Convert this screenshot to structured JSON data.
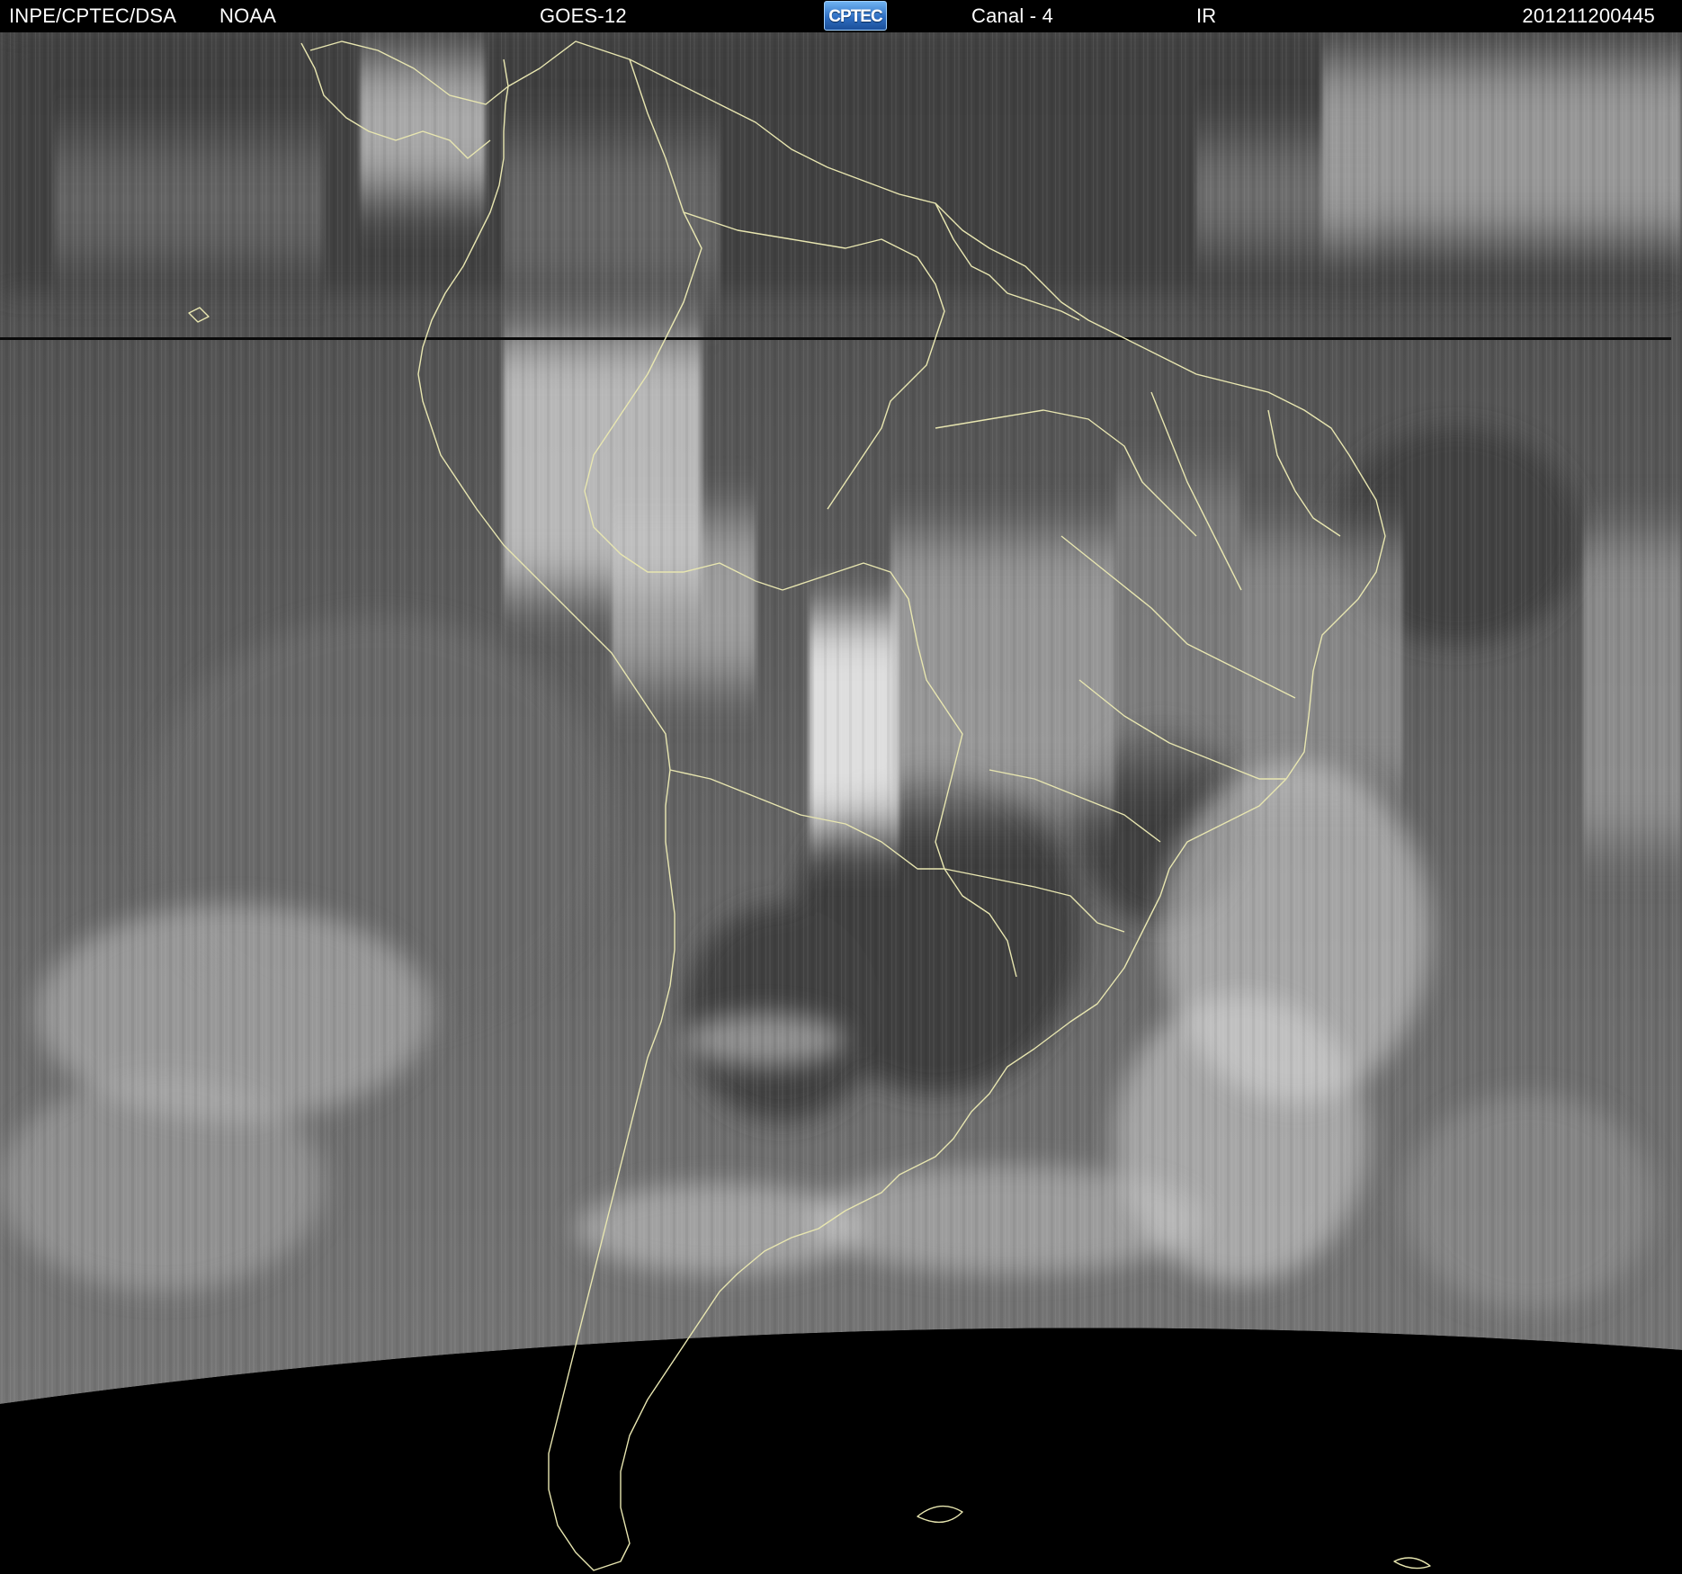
{
  "header": {
    "agency": "INPE/CPTEC/DSA",
    "org": "NOAA",
    "satellite": "GOES-12",
    "logo_text": "CPTEC",
    "channel": "Canal - 4",
    "band": "IR",
    "timestamp": "201211200445"
  },
  "colors": {
    "background": "#000000",
    "header_text": "#ffffff",
    "coastline": "#e8e6b0",
    "cloud_bright": "#f2f2f2",
    "cloud_dark": "#3a3a3a",
    "space": "#000000"
  },
  "map": {
    "type": "satellite-infrared-image",
    "region": "South America",
    "overlay": "country and state borders"
  }
}
